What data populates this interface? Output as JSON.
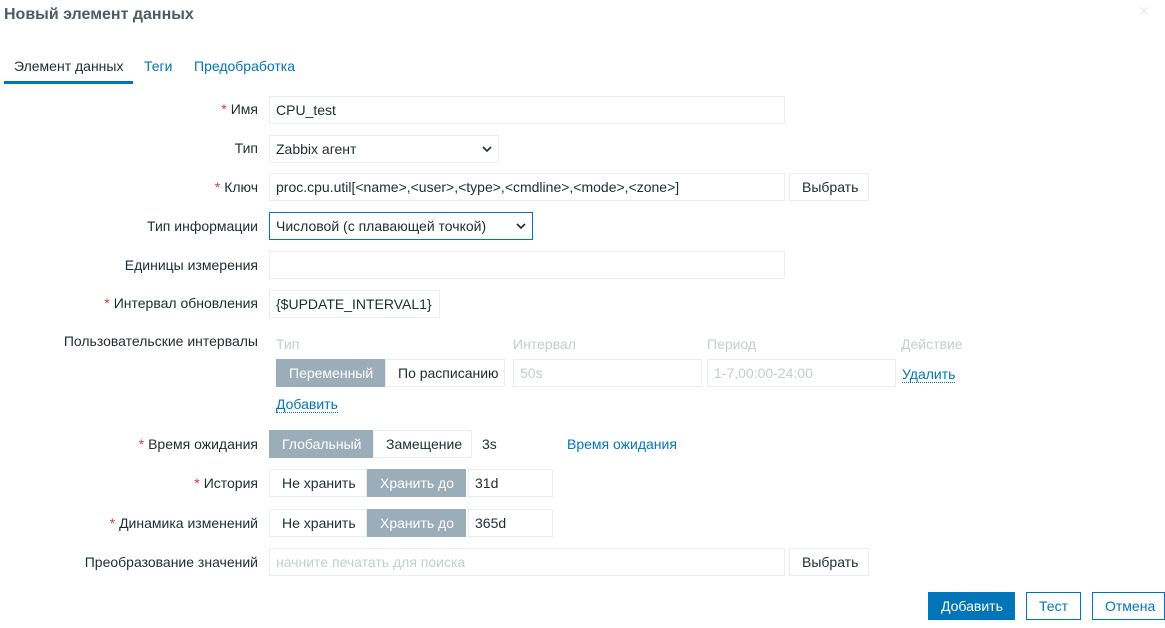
{
  "dialog": {
    "title": "Новый элемент данных",
    "close_icon": "close-icon"
  },
  "tabs": [
    {
      "label": "Элемент данных",
      "active": true
    },
    {
      "label": "Теги",
      "active": false
    },
    {
      "label": "Предобработка",
      "active": false
    }
  ],
  "form": {
    "name": {
      "label": "Имя",
      "required": true,
      "value": "CPU_test"
    },
    "type": {
      "label": "Тип",
      "value": "Zabbix агент"
    },
    "key": {
      "label": "Ключ",
      "required": true,
      "value": "proc.cpu.util[<name>,<user>,<type>,<cmdline>,<mode>,<zone>]",
      "select_label": "Выбрать"
    },
    "info_type": {
      "label": "Тип информации",
      "value": "Числовой (с плавающей точкой)"
    },
    "units": {
      "label": "Единицы измерения",
      "value": ""
    },
    "update_interval": {
      "label": "Интервал обновления",
      "required": true,
      "value": "{$UPDATE_INTERVAL1}"
    },
    "custom_intervals": {
      "label": "Пользовательские интервалы",
      "headers": {
        "type": "Тип",
        "interval": "Интервал",
        "period": "Период",
        "action": "Действие"
      },
      "row": {
        "type_options": [
          "Переменный",
          "По расписанию"
        ],
        "type_selected": "Переменный",
        "interval_placeholder": "50s",
        "period_placeholder": "1-7,00:00-24:00",
        "remove_label": "Удалить"
      },
      "add_label": "Добавить"
    },
    "timeout": {
      "label": "Время ожидания",
      "required": true,
      "options": [
        "Глобальный",
        "Замещение"
      ],
      "selected": "Глобальный",
      "value": "3s",
      "link": "Время ожидания"
    },
    "history": {
      "label": "История",
      "required": true,
      "options": [
        "Не хранить",
        "Хранить до"
      ],
      "selected": "Хранить до",
      "value": "31d"
    },
    "trends": {
      "label": "Динамика изменений",
      "required": true,
      "options": [
        "Не хранить",
        "Хранить до"
      ],
      "selected": "Хранить до",
      "value": "365d"
    },
    "valuemap": {
      "label": "Преобразование значений",
      "placeholder": "начните печатать для поиска",
      "select_label": "Выбрать"
    }
  },
  "footer": {
    "add_label": "Добавить",
    "test_label": "Тест",
    "cancel_label": "Отмена"
  },
  "colors": {
    "accent": "#0275b8",
    "segment_active": "#9aadb9",
    "required_star": "#e33734",
    "border": "#ebeef0"
  }
}
